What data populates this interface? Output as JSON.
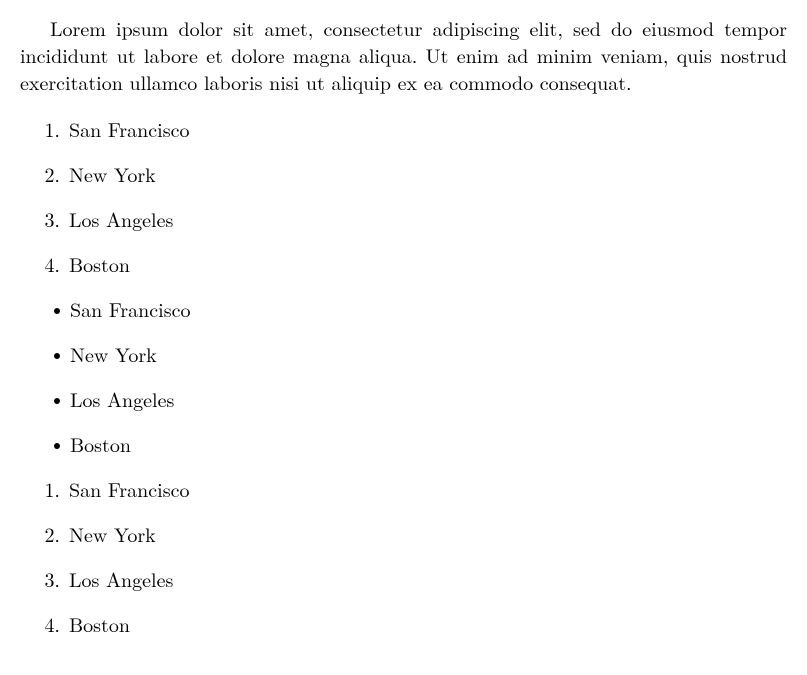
{
  "paragraph": "Lorem ipsum dolor sit amet, consectetur adipiscing elit, sed do eiusmod tempor incididunt ut labore et dolore magna aliqua. Ut enim ad minim veniam, quis nostrud exercitation ullamco laboris nisi ut aliquip ex ea commodo consequat.",
  "lists": {
    "ordered1": {
      "markers": [
        "1.",
        "2.",
        "3.",
        "4."
      ],
      "items": [
        "San Francisco",
        "New York",
        "Los Angeles",
        "Boston"
      ]
    },
    "unordered": {
      "items": [
        "San Francisco",
        "New York",
        "Los Angeles",
        "Boston"
      ]
    },
    "ordered2": {
      "markers": [
        "1.",
        "2.",
        "3.",
        "4."
      ],
      "items": [
        "San Francisco",
        "New York",
        "Los Angeles",
        "Boston"
      ]
    }
  }
}
